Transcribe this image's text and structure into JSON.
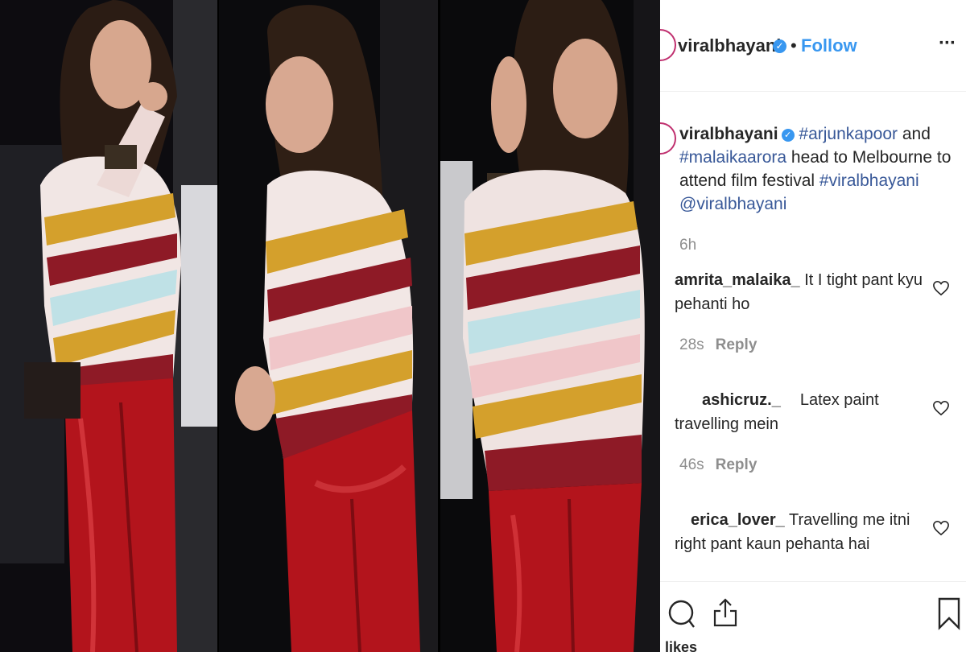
{
  "post": {
    "author": "viralbhayani",
    "separator": "•",
    "follow_label": "Follow",
    "more_label": "···",
    "verified_mark": "✓",
    "caption": {
      "username": "viralbhayani",
      "tag1": "#arjunkapoor",
      "text1": " and ",
      "tag2": "#malaikaarora",
      "text2": " head to Melbourne to attend film festival ",
      "tag3": "#viralbhayani",
      "mention": "@viralbhayani"
    },
    "time": "6h"
  },
  "comments": [
    {
      "username": "amrita_malaika_",
      "text": "It I tight pant kyu pehanti ho",
      "time": "28s",
      "reply_label": "Reply"
    },
    {
      "username": "ashicruz._",
      "text": "Latex paint travelling mein",
      "time": "46s",
      "reply_label": "Reply"
    },
    {
      "username": "erica_lover_",
      "text": "Travelling me itni right pant kaun pehanta hai"
    }
  ],
  "footer": {
    "likes_label": "likes"
  },
  "icons": {
    "options": "more-options-icon",
    "like": "heart-icon",
    "comment": "comment-icon",
    "share": "share-icon",
    "save": "bookmark-icon",
    "verified": "verified-badge-icon"
  },
  "colors": {
    "link": "#3897f0",
    "tag": "#385898",
    "muted": "#8e8e8e",
    "text": "#262626",
    "sweater_red": "#8e1a26",
    "pants_red": "#b3141c",
    "mustard": "#d4a02c"
  }
}
